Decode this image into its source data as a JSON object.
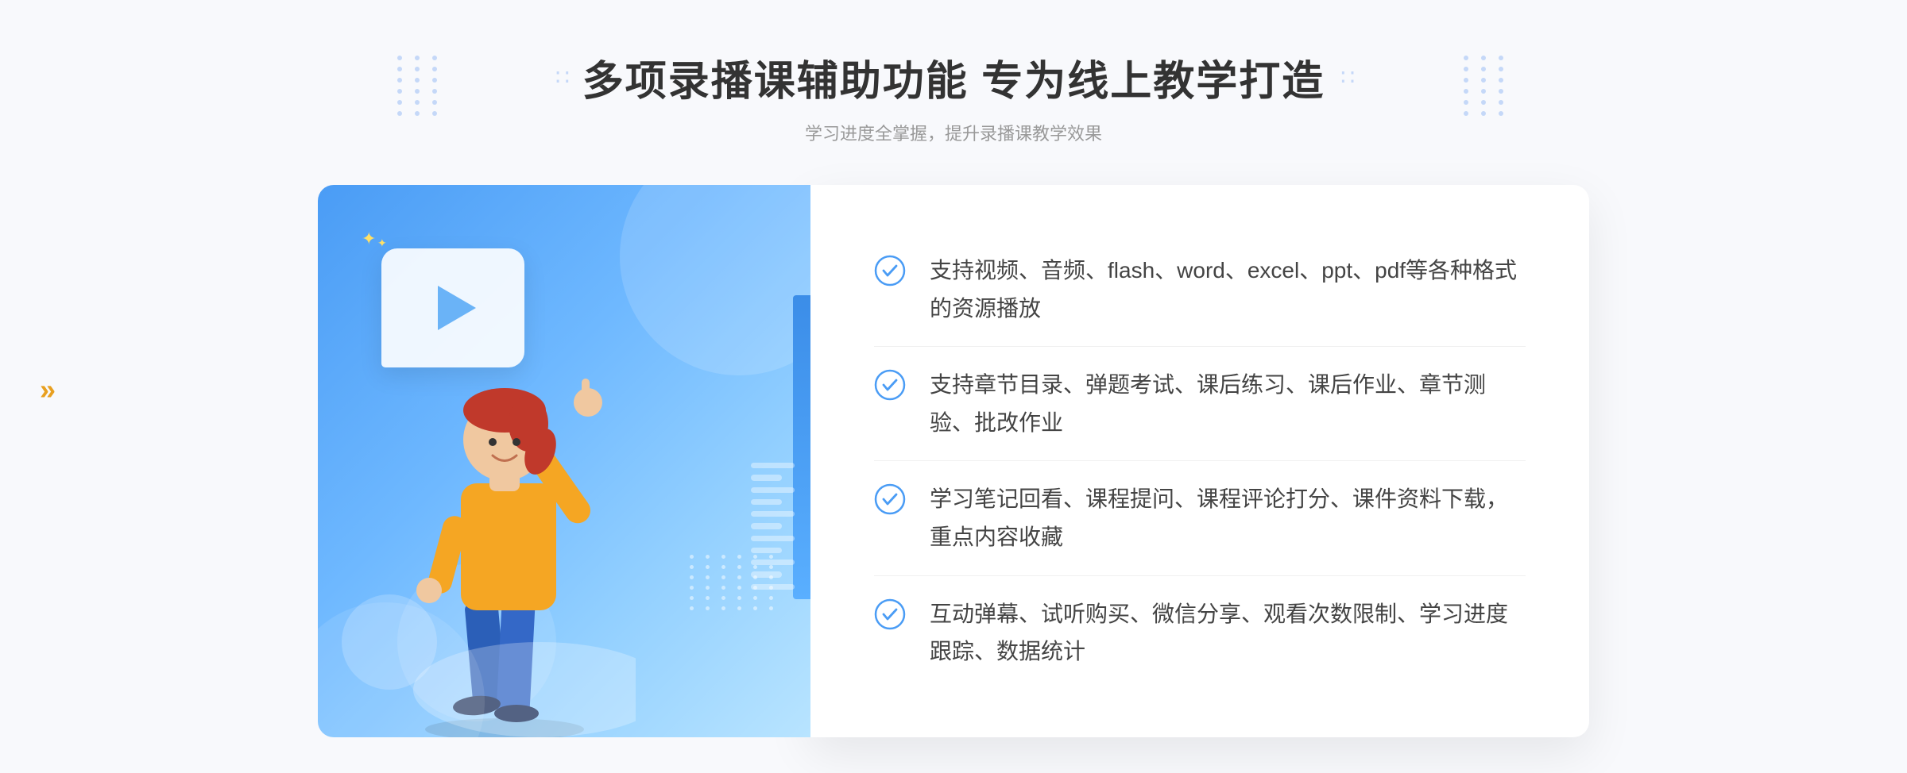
{
  "header": {
    "title": "多项录播课辅助功能 专为线上教学打造",
    "subtitle": "学习进度全掌握，提升录播课教学效果",
    "deco_left": "∷",
    "deco_right": "∷"
  },
  "features": [
    {
      "id": 1,
      "text": "支持视频、音频、flash、word、excel、ppt、pdf等各种格式的资源播放"
    },
    {
      "id": 2,
      "text": "支持章节目录、弹题考试、课后练习、课后作业、章节测验、批改作业"
    },
    {
      "id": 3,
      "text": "学习笔记回看、课程提问、课程评论打分、课件资料下载，重点内容收藏"
    },
    {
      "id": 4,
      "text": "互动弹幕、试听购买、微信分享、观看次数限制、学习进度跟踪、数据统计"
    }
  ],
  "chevron_symbol": "»",
  "play_icon": "▶"
}
